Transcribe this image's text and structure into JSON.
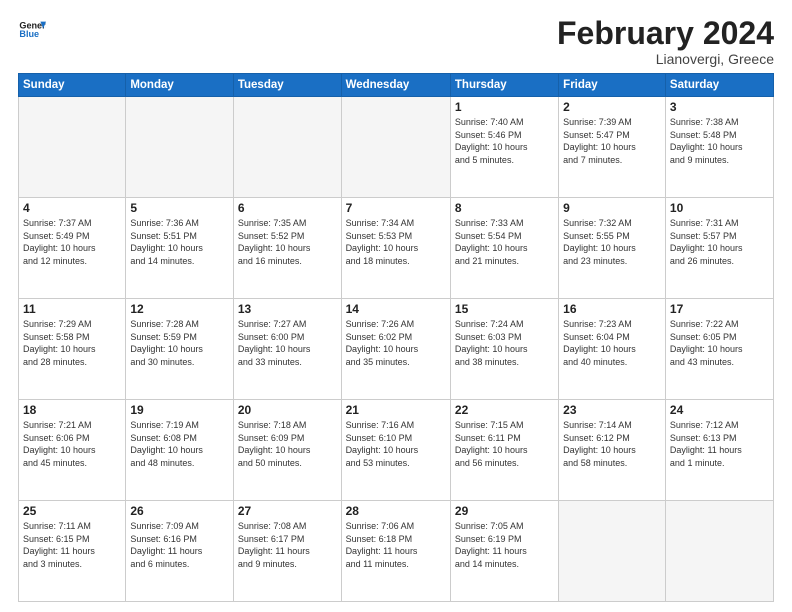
{
  "logo": {
    "line1": "General",
    "line2": "Blue"
  },
  "title": "February 2024",
  "subtitle": "Lianovergi, Greece",
  "header": {
    "days": [
      "Sunday",
      "Monday",
      "Tuesday",
      "Wednesday",
      "Thursday",
      "Friday",
      "Saturday"
    ]
  },
  "weeks": [
    [
      {
        "day": "",
        "info": ""
      },
      {
        "day": "",
        "info": ""
      },
      {
        "day": "",
        "info": ""
      },
      {
        "day": "",
        "info": ""
      },
      {
        "day": "1",
        "info": "Sunrise: 7:40 AM\nSunset: 5:46 PM\nDaylight: 10 hours\nand 5 minutes."
      },
      {
        "day": "2",
        "info": "Sunrise: 7:39 AM\nSunset: 5:47 PM\nDaylight: 10 hours\nand 7 minutes."
      },
      {
        "day": "3",
        "info": "Sunrise: 7:38 AM\nSunset: 5:48 PM\nDaylight: 10 hours\nand 9 minutes."
      }
    ],
    [
      {
        "day": "4",
        "info": "Sunrise: 7:37 AM\nSunset: 5:49 PM\nDaylight: 10 hours\nand 12 minutes."
      },
      {
        "day": "5",
        "info": "Sunrise: 7:36 AM\nSunset: 5:51 PM\nDaylight: 10 hours\nand 14 minutes."
      },
      {
        "day": "6",
        "info": "Sunrise: 7:35 AM\nSunset: 5:52 PM\nDaylight: 10 hours\nand 16 minutes."
      },
      {
        "day": "7",
        "info": "Sunrise: 7:34 AM\nSunset: 5:53 PM\nDaylight: 10 hours\nand 18 minutes."
      },
      {
        "day": "8",
        "info": "Sunrise: 7:33 AM\nSunset: 5:54 PM\nDaylight: 10 hours\nand 21 minutes."
      },
      {
        "day": "9",
        "info": "Sunrise: 7:32 AM\nSunset: 5:55 PM\nDaylight: 10 hours\nand 23 minutes."
      },
      {
        "day": "10",
        "info": "Sunrise: 7:31 AM\nSunset: 5:57 PM\nDaylight: 10 hours\nand 26 minutes."
      }
    ],
    [
      {
        "day": "11",
        "info": "Sunrise: 7:29 AM\nSunset: 5:58 PM\nDaylight: 10 hours\nand 28 minutes."
      },
      {
        "day": "12",
        "info": "Sunrise: 7:28 AM\nSunset: 5:59 PM\nDaylight: 10 hours\nand 30 minutes."
      },
      {
        "day": "13",
        "info": "Sunrise: 7:27 AM\nSunset: 6:00 PM\nDaylight: 10 hours\nand 33 minutes."
      },
      {
        "day": "14",
        "info": "Sunrise: 7:26 AM\nSunset: 6:02 PM\nDaylight: 10 hours\nand 35 minutes."
      },
      {
        "day": "15",
        "info": "Sunrise: 7:24 AM\nSunset: 6:03 PM\nDaylight: 10 hours\nand 38 minutes."
      },
      {
        "day": "16",
        "info": "Sunrise: 7:23 AM\nSunset: 6:04 PM\nDaylight: 10 hours\nand 40 minutes."
      },
      {
        "day": "17",
        "info": "Sunrise: 7:22 AM\nSunset: 6:05 PM\nDaylight: 10 hours\nand 43 minutes."
      }
    ],
    [
      {
        "day": "18",
        "info": "Sunrise: 7:21 AM\nSunset: 6:06 PM\nDaylight: 10 hours\nand 45 minutes."
      },
      {
        "day": "19",
        "info": "Sunrise: 7:19 AM\nSunset: 6:08 PM\nDaylight: 10 hours\nand 48 minutes."
      },
      {
        "day": "20",
        "info": "Sunrise: 7:18 AM\nSunset: 6:09 PM\nDaylight: 10 hours\nand 50 minutes."
      },
      {
        "day": "21",
        "info": "Sunrise: 7:16 AM\nSunset: 6:10 PM\nDaylight: 10 hours\nand 53 minutes."
      },
      {
        "day": "22",
        "info": "Sunrise: 7:15 AM\nSunset: 6:11 PM\nDaylight: 10 hours\nand 56 minutes."
      },
      {
        "day": "23",
        "info": "Sunrise: 7:14 AM\nSunset: 6:12 PM\nDaylight: 10 hours\nand 58 minutes."
      },
      {
        "day": "24",
        "info": "Sunrise: 7:12 AM\nSunset: 6:13 PM\nDaylight: 11 hours\nand 1 minute."
      }
    ],
    [
      {
        "day": "25",
        "info": "Sunrise: 7:11 AM\nSunset: 6:15 PM\nDaylight: 11 hours\nand 3 minutes."
      },
      {
        "day": "26",
        "info": "Sunrise: 7:09 AM\nSunset: 6:16 PM\nDaylight: 11 hours\nand 6 minutes."
      },
      {
        "day": "27",
        "info": "Sunrise: 7:08 AM\nSunset: 6:17 PM\nDaylight: 11 hours\nand 9 minutes."
      },
      {
        "day": "28",
        "info": "Sunrise: 7:06 AM\nSunset: 6:18 PM\nDaylight: 11 hours\nand 11 minutes."
      },
      {
        "day": "29",
        "info": "Sunrise: 7:05 AM\nSunset: 6:19 PM\nDaylight: 11 hours\nand 14 minutes."
      },
      {
        "day": "",
        "info": ""
      },
      {
        "day": "",
        "info": ""
      }
    ]
  ]
}
